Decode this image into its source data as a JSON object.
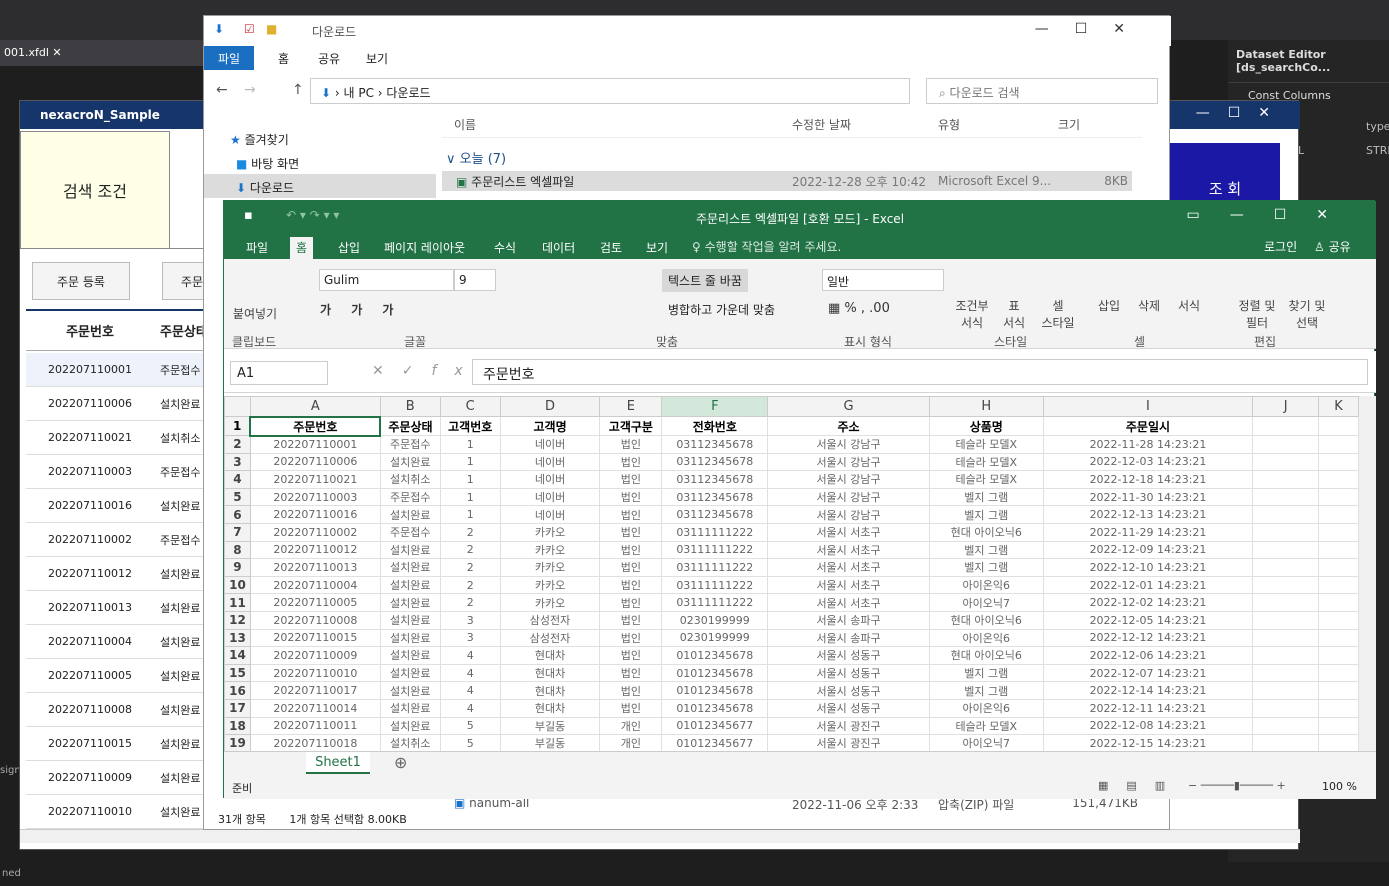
{
  "ide": {
    "tab_label": "001.xfdl",
    "dataset_title": "Dataset Editor [ds_searchCo...",
    "const_columns": "Const Columns",
    "type_col": "type",
    "col_l": "L",
    "col_stri": "STRI",
    "status_left": "ned",
    "side_sign": "sign"
  },
  "nexacro": {
    "title": "nexacroN_Sample",
    "condition_label": "검색 조건",
    "search_button": "조 회",
    "order_register": "주문 등록",
    "order_btn2": "주문",
    "col_order_no": "주문번호",
    "col_status": "주문상태",
    "rows": [
      [
        "202207110001",
        "주문접수"
      ],
      [
        "202207110006",
        "설치완료"
      ],
      [
        "202207110021",
        "설치취소"
      ],
      [
        "202207110003",
        "주문접수"
      ],
      [
        "202207110016",
        "설치완료"
      ],
      [
        "202207110002",
        "주문접수"
      ],
      [
        "202207110012",
        "설치완료"
      ],
      [
        "202207110013",
        "설치완료"
      ],
      [
        "202207110004",
        "설치완료"
      ],
      [
        "202207110005",
        "설치완료"
      ],
      [
        "202207110008",
        "설치완료"
      ],
      [
        "202207110015",
        "설치완료"
      ],
      [
        "202207110009",
        "설치완료"
      ],
      [
        "202207110010",
        "설치완료"
      ]
    ]
  },
  "explorer": {
    "title": "다운로드",
    "tabs": [
      "파일",
      "홈",
      "공유",
      "보기"
    ],
    "path": [
      "내 PC",
      "다운로드"
    ],
    "search_placeholder": "다운로드 검색",
    "nav": [
      "즐겨찾기",
      "바탕 화면",
      "다운로드"
    ],
    "cols": [
      "이름",
      "수정한 날짜",
      "유형",
      "크기"
    ],
    "group": "오늘 (7)",
    "file": {
      "name": "주문리스트 엑셀파일",
      "date": "2022-12-28 오후 10:42",
      "type": "Microsoft Excel 9...",
      "size": "8KB"
    },
    "file2": {
      "name": "nanum-all",
      "date": "2022-11-06 오후 2:33",
      "type": "압축(ZIP) 파일",
      "size": "151,471KB"
    },
    "status_count": "31개 항목",
    "status_sel": "1개 항목 선택함 8.00KB"
  },
  "excel": {
    "title": "주문리스트 엑셀파일  [호환 모드] - Excel",
    "tabs": [
      "파일",
      "홈",
      "삽입",
      "페이지 레이아웃",
      "수식",
      "데이터",
      "검토",
      "보기"
    ],
    "tell_me": "수행할 작업을 알려 주세요.",
    "login": "로그인",
    "share": "공유",
    "font": "Gulim",
    "font_size": "9",
    "wrap_text": "텍스트 줄 바꿈",
    "merge": "병합하고 가운데 맞춤",
    "number_format": "일반",
    "groups": [
      "클립보드",
      "글꼴",
      "맞춤",
      "표시 형식",
      "스타일",
      "셀",
      "편집"
    ],
    "paste": "붙여넣기",
    "cond_format": "조건부\n서식",
    "table_format": "표\n서식",
    "cell_style": "셀\n스타일",
    "insert": "삽입",
    "delete": "삭제",
    "format": "서식",
    "sort": "정렬 및\n필터",
    "find": "찾기 및\n선택",
    "name_box": "A1",
    "formula": "주문번호",
    "columns": [
      "A",
      "B",
      "C",
      "D",
      "E",
      "F",
      "G",
      "H",
      "I",
      "J",
      "K"
    ],
    "header": [
      "주문번호",
      "주문상태",
      "고객번호",
      "고객명",
      "고객구분",
      "전화번호",
      "주소",
      "상품명",
      "주문일시"
    ],
    "rows": [
      [
        "202207110001",
        "주문접수",
        "1",
        "네이버",
        "법인",
        "03112345678",
        "서울시 강남구",
        "테슬라 모델X",
        "2022-11-28 14:23:21"
      ],
      [
        "202207110006",
        "설치완료",
        "1",
        "네이버",
        "법인",
        "03112345678",
        "서울시 강남구",
        "테슬라 모델X",
        "2022-12-03 14:23:21"
      ],
      [
        "202207110021",
        "설치취소",
        "1",
        "네이버",
        "법인",
        "03112345678",
        "서울시 강남구",
        "테슬라 모델X",
        "2022-12-18 14:23:21"
      ],
      [
        "202207110003",
        "주문접수",
        "1",
        "네이버",
        "법인",
        "03112345678",
        "서울시 강남구",
        "벨지 그램",
        "2022-11-30 14:23:21"
      ],
      [
        "202207110016",
        "설치완료",
        "1",
        "네이버",
        "법인",
        "03112345678",
        "서울시 강남구",
        "벨지 그램",
        "2022-12-13 14:23:21"
      ],
      [
        "202207110002",
        "주문접수",
        "2",
        "카카오",
        "법인",
        "03111111222",
        "서울시 서초구",
        "현대 아이오닉6",
        "2022-11-29 14:23:21"
      ],
      [
        "202207110012",
        "설치완료",
        "2",
        "카카오",
        "법인",
        "03111111222",
        "서울시 서초구",
        "벨지 그램",
        "2022-12-09 14:23:21"
      ],
      [
        "202207110013",
        "설치완료",
        "2",
        "카카오",
        "법인",
        "03111111222",
        "서울시 서초구",
        "벨지 그램",
        "2022-12-10 14:23:21"
      ],
      [
        "202207110004",
        "설치완료",
        "2",
        "카카오",
        "법인",
        "03111111222",
        "서울시 서초구",
        "아이온익6",
        "2022-12-01 14:23:21"
      ],
      [
        "202207110005",
        "설치완료",
        "2",
        "카카오",
        "법인",
        "03111111222",
        "서울시 서초구",
        "아이오닉7",
        "2022-12-02 14:23:21"
      ],
      [
        "202207110008",
        "설치완료",
        "3",
        "삼성전자",
        "법인",
        "0230199999",
        "서울시 송파구",
        "현대 아이오닉6",
        "2022-12-05 14:23:21"
      ],
      [
        "202207110015",
        "설치완료",
        "3",
        "삼성전자",
        "법인",
        "0230199999",
        "서울시 송파구",
        "아이온익6",
        "2022-12-12 14:23:21"
      ],
      [
        "202207110009",
        "설치완료",
        "4",
        "현대차",
        "법인",
        "01012345678",
        "서울시 성동구",
        "현대 아이오닉6",
        "2022-12-06 14:23:21"
      ],
      [
        "202207110010",
        "설치완료",
        "4",
        "현대차",
        "법인",
        "01012345678",
        "서울시 성동구",
        "벨지 그램",
        "2022-12-07 14:23:21"
      ],
      [
        "202207110017",
        "설치완료",
        "4",
        "현대차",
        "법인",
        "01012345678",
        "서울시 성동구",
        "벨지 그램",
        "2022-12-14 14:23:21"
      ],
      [
        "202207110014",
        "설치완료",
        "4",
        "현대차",
        "법인",
        "01012345678",
        "서울시 성동구",
        "아이온익6",
        "2022-12-11 14:23:21"
      ],
      [
        "202207110011",
        "설치완료",
        "5",
        "부길동",
        "개인",
        "01012345677",
        "서울시 광진구",
        "테슬라 모델X",
        "2022-12-08 14:23:21"
      ],
      [
        "202207110018",
        "설치취소",
        "5",
        "부길동",
        "개인",
        "01012345677",
        "서울시 광진구",
        "아이오닉7",
        "2022-12-15 14:23:21"
      ]
    ],
    "sheet_tab": "Sheet1",
    "ready": "준비",
    "zoom": "100 %"
  }
}
